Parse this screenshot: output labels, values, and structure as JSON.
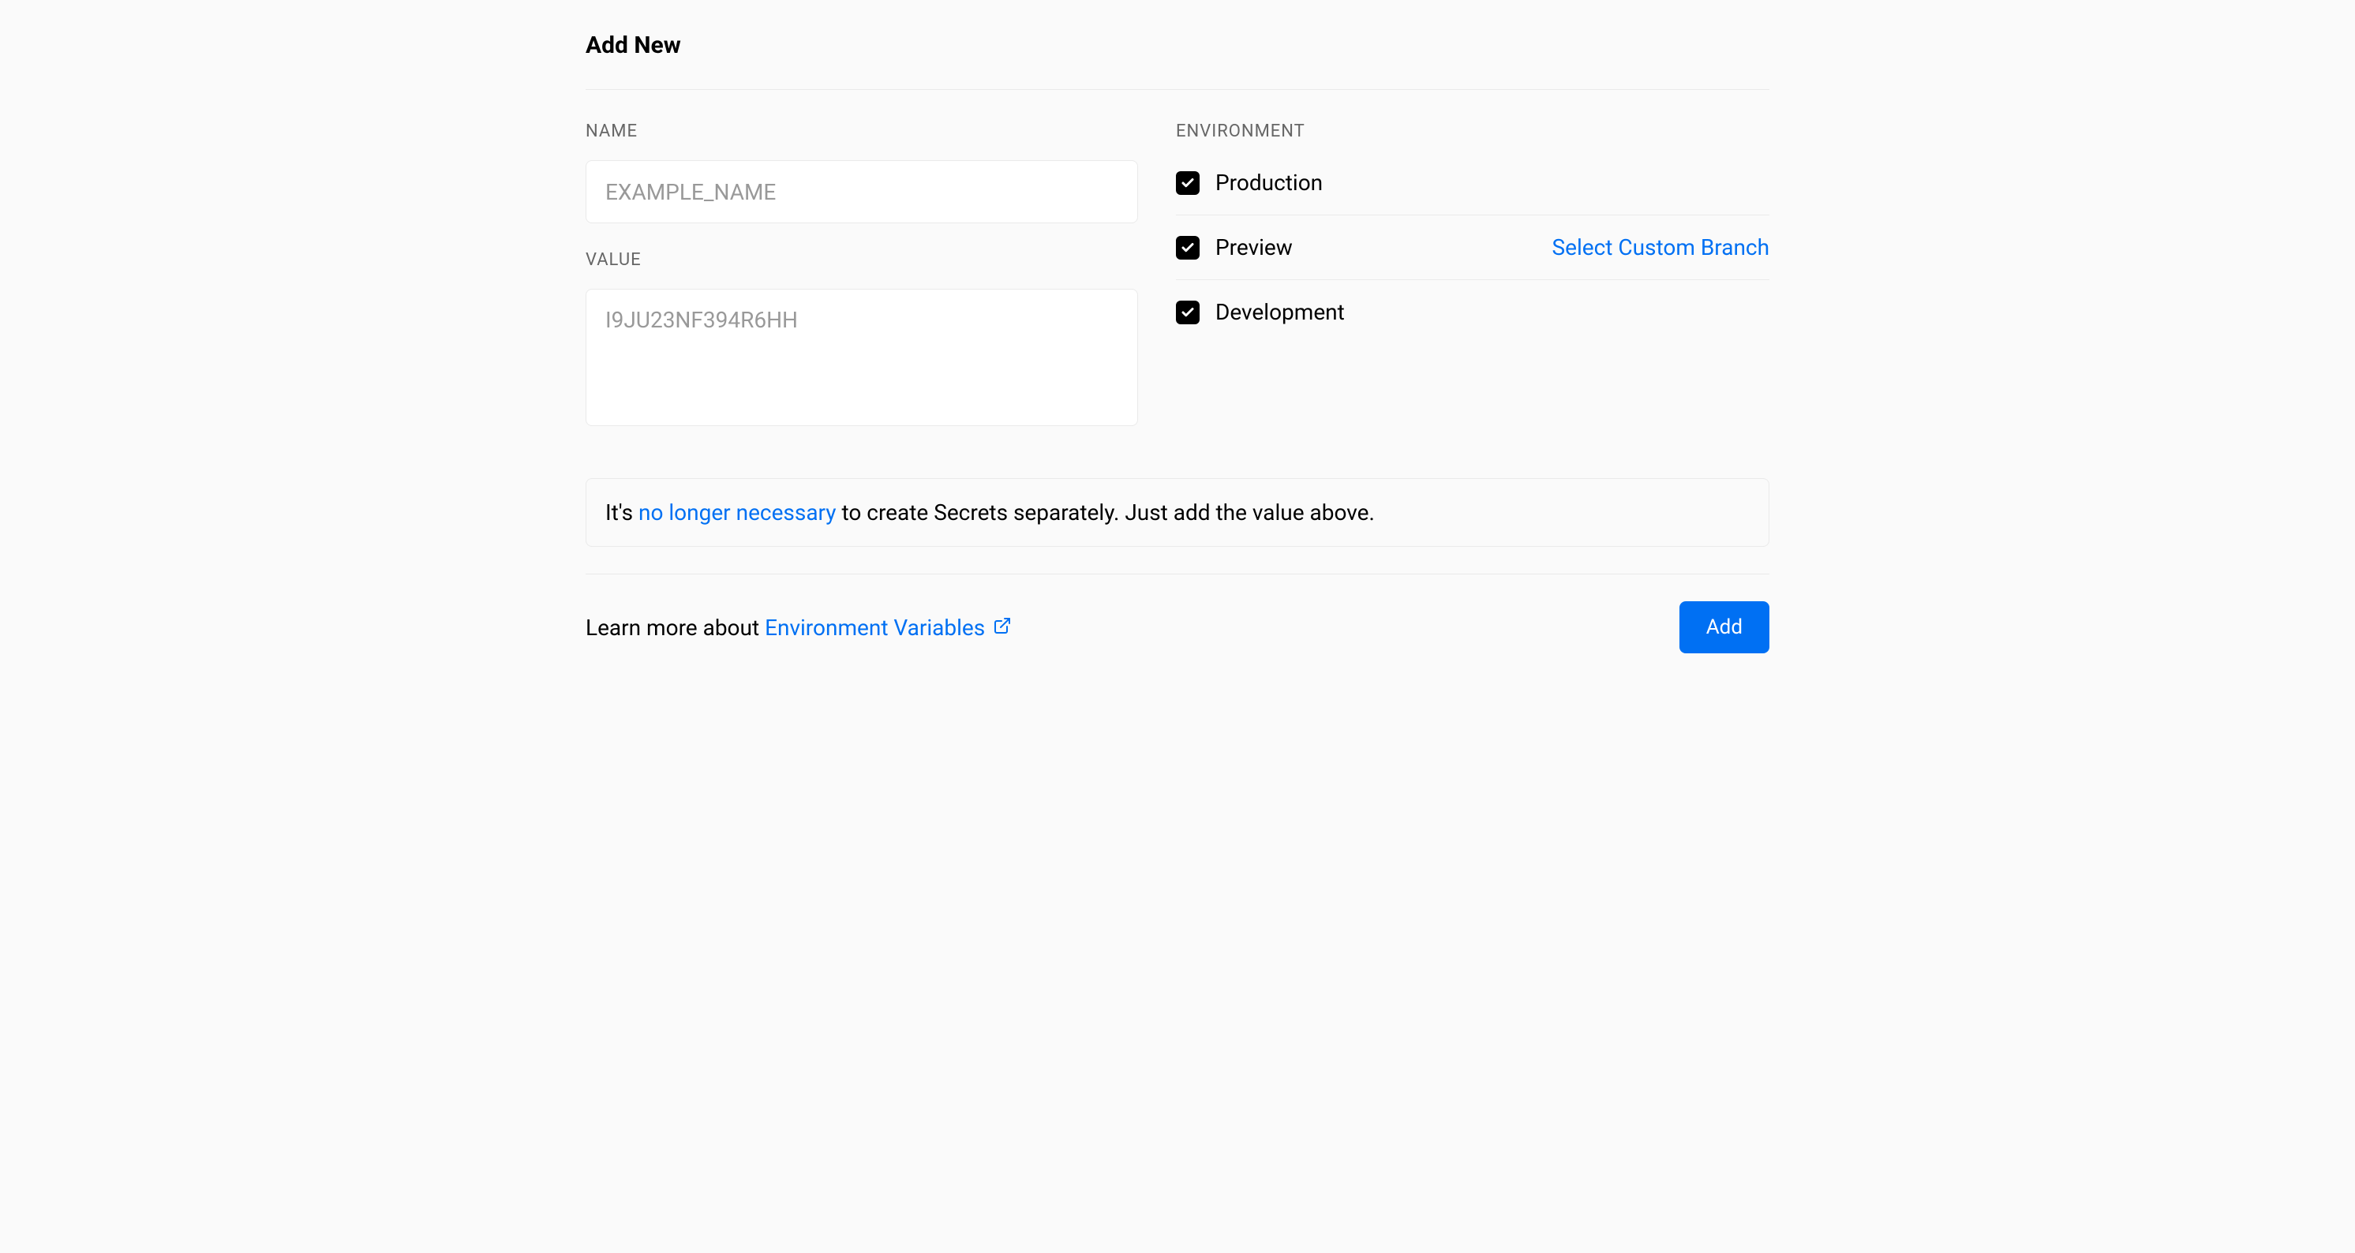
{
  "title": "Add New",
  "name_field": {
    "label": "NAME",
    "placeholder": "EXAMPLE_NAME",
    "value": ""
  },
  "value_field": {
    "label": "VALUE",
    "placeholder": "I9JU23NF394R6HH",
    "value": ""
  },
  "environment": {
    "label": "ENVIRONMENT",
    "options": [
      {
        "label": "Production",
        "checked": true,
        "custom_branch": null
      },
      {
        "label": "Preview",
        "checked": true,
        "custom_branch": "Select Custom Branch"
      },
      {
        "label": "Development",
        "checked": true,
        "custom_branch": null
      }
    ]
  },
  "info": {
    "prefix": "It's ",
    "link_text": "no longer necessary",
    "suffix": " to create Secrets separately. Just add the value above."
  },
  "footer": {
    "prefix": "Learn more about ",
    "link_text": "Environment Variables",
    "button": "Add"
  }
}
